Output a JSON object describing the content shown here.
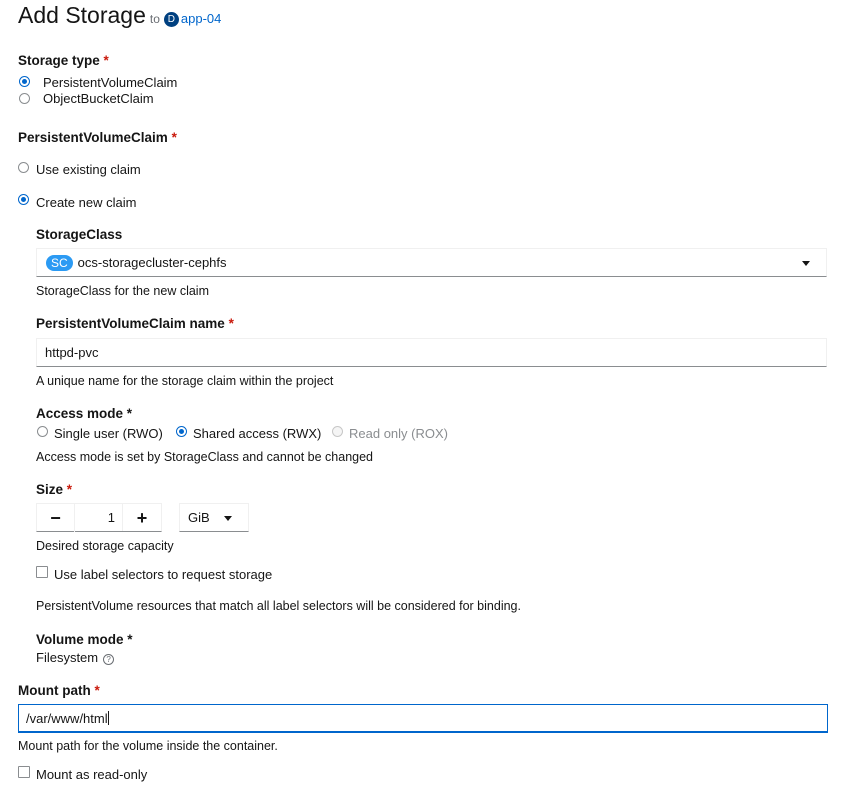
{
  "header": {
    "title": "Add Storage",
    "to_text": "to",
    "namespace_badge": "D",
    "namespace_link": "app-04"
  },
  "storage_type": {
    "label": "Storage type",
    "required_mark": "*",
    "options": [
      {
        "label": "PersistentVolumeClaim",
        "selected": true
      },
      {
        "label": "ObjectBucketClaim",
        "selected": false
      }
    ]
  },
  "pvc": {
    "label": "PersistentVolumeClaim",
    "required_mark": "*",
    "options": [
      {
        "label": "Use existing claim",
        "selected": false
      },
      {
        "label": "Create new claim",
        "selected": true
      }
    ]
  },
  "storage_class": {
    "label": "StorageClass",
    "badge": "SC",
    "value": "ocs-storagecluster-cephfs",
    "help": "StorageClass for the new claim"
  },
  "pvc_name": {
    "label": "PersistentVolumeClaim name",
    "required_mark": "*",
    "value": "httpd-pvc",
    "help": "A unique name for the storage claim within the project"
  },
  "access_mode": {
    "label": "Access mode *",
    "options": [
      {
        "label": "Single user (RWO)",
        "selected": false,
        "disabled": false
      },
      {
        "label": "Shared access (RWX)",
        "selected": true,
        "disabled": false
      },
      {
        "label": "Read only (ROX)",
        "selected": false,
        "disabled": true
      }
    ],
    "help": "Access mode is set by StorageClass and cannot be changed"
  },
  "size": {
    "label": "Size",
    "required_mark": "*",
    "minus_symbol": "−",
    "plus_symbol": "+",
    "value": "1",
    "unit": "GiB",
    "help": "Desired storage capacity"
  },
  "label_selectors": {
    "label": "Use label selectors to request storage",
    "checked": false,
    "help": "PersistentVolume resources that match all label selectors will be considered for binding."
  },
  "volume_mode": {
    "label": "Volume mode *",
    "value": "Filesystem",
    "info_symbol": "?"
  },
  "mount_path": {
    "label": "Mount path",
    "required_mark": "*",
    "value": "/var/www/html",
    "help": "Mount path for the volume inside the container."
  },
  "read_only": {
    "label": "Mount as read-only",
    "checked": false
  },
  "colors": {
    "primary": "#0066cc",
    "required": "#c9190b",
    "badge_sc": "#2b9af3",
    "badge_ns": "#004080"
  }
}
